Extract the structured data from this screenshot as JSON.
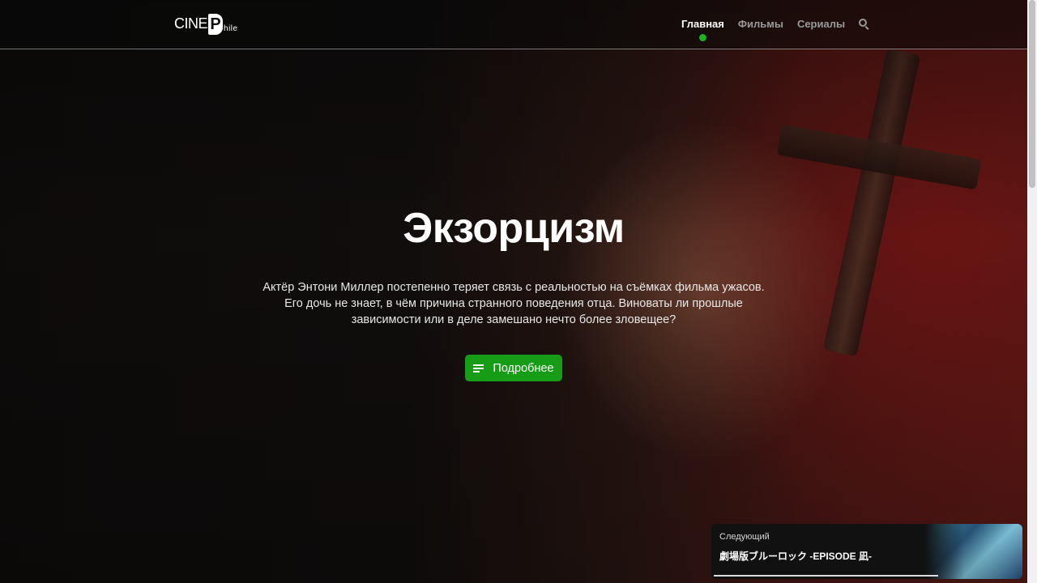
{
  "logo": {
    "cine": "CINE",
    "p": "P",
    "hile": "hile"
  },
  "nav": {
    "items": [
      {
        "label": "Главная",
        "active": true
      },
      {
        "label": "Фильмы",
        "active": false
      },
      {
        "label": "Сериалы",
        "active": false
      }
    ],
    "search_icon": "search-icon"
  },
  "hero": {
    "title": "Экзорцизм",
    "description": "Актёр Энтони Миллер постепенно теряет связь с реальностью на съёмках фильма ужасов. Его дочь не знает, в чём причина странного поведения отца. Виноваты ли прошлые зависимости или в деле замешано нечто более зловещее?",
    "button_label": "Подробнее",
    "button_icon": "menu-icon"
  },
  "next": {
    "label": "Следующий",
    "title": "劇場版ブルーロック -EPISODE 凪-"
  },
  "colors": {
    "accent": "#169c16",
    "active_dot": "#1cb41c",
    "nav_inactive": "#9a9a9a"
  }
}
